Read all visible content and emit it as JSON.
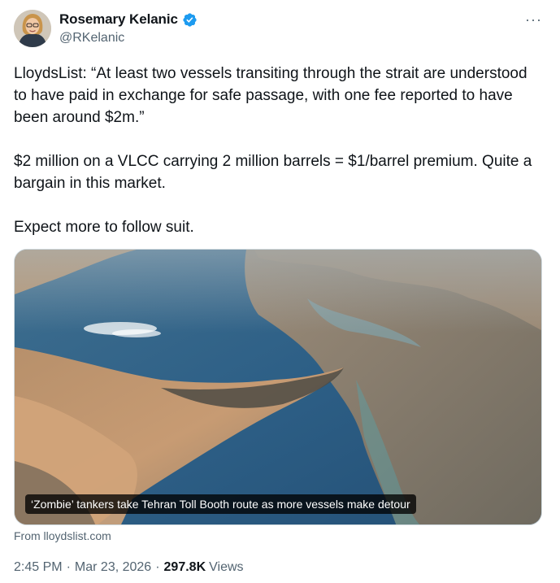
{
  "author": {
    "display_name": "Rosemary Kelanic",
    "handle": "@RKelanic",
    "verified_icon": "verified-badge-icon",
    "accent_color": "#1d9bf0"
  },
  "menu": {
    "more_label": "···"
  },
  "tweet": {
    "paragraphs": [
      "LloydsList: “At least two vessels transiting through the strait are understood to have paid in exchange for safe passage, with one fee reported to have been around $2m.”",
      "$2 million on a VLCC carrying 2 million barrels = $1/barrel premium. Quite a bargain in this market.",
      "Expect more to follow suit."
    ]
  },
  "link_card": {
    "caption": "‘Zombie’ tankers take Tehran Toll Booth route as more vessels make detour",
    "source": "From lloydslist.com"
  },
  "meta": {
    "time": "2:45 PM",
    "date": "Mar 23, 2026",
    "views_count": "297.8K",
    "views_label": "Views",
    "separator": "·"
  }
}
